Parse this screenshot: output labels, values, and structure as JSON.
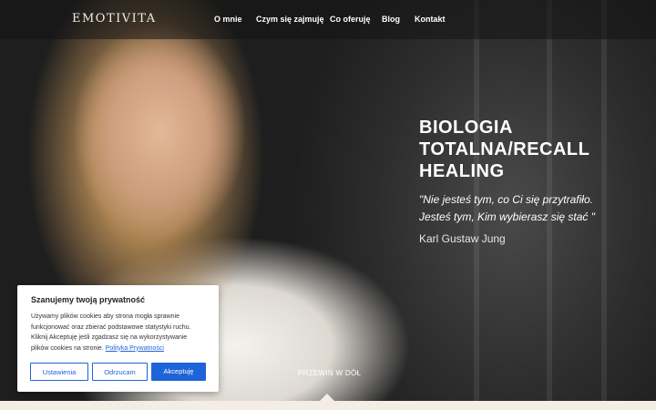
{
  "header": {
    "logo": "EMOTIVITA",
    "nav": [
      "O mnie",
      "Czym się zajmuję",
      "Co oferuję",
      "Blog",
      "Kontakt"
    ]
  },
  "hero": {
    "title_lines": [
      "BIOLOGIA",
      "TOTALNA/RECALL",
      "HEALING"
    ],
    "quote_lines": [
      "\"Nie jesteś tym, co Ci się przytrafiło.",
      "Jesteś tym, Kim wybierasz się stać \""
    ],
    "author": "Karl Gustaw Jung",
    "scroll_label": "PRZEWIŃ W DÓŁ"
  },
  "cookie": {
    "title": "Szanujemy twoją prywatność",
    "text_lines": [
      "Używamy plików cookies aby strona mogła sprawnie",
      "funkcjonować oraz zbierać podstawowe statystyki ruchu.",
      "Kliknij Akceptuję jeśli zgadzasz się na wykorzystywanie",
      "plików cookies na stronie."
    ],
    "policy_link": "Polityka Prywatności",
    "buttons": {
      "settings": "Ustawienia",
      "reject": "Odrzucam",
      "accept": "Akceptuję"
    }
  },
  "colors": {
    "accent": "#1f63d8",
    "page_bg": "#f4ede6"
  }
}
